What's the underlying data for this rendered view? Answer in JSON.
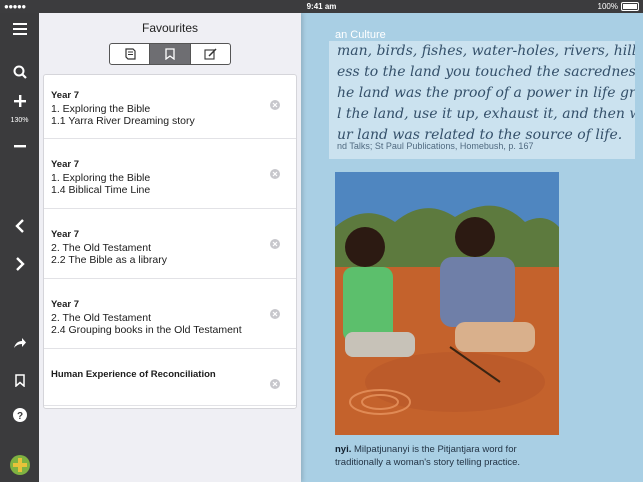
{
  "status": {
    "carrier_dots": "●●●●●",
    "time": "9:41 am",
    "battery": "100%"
  },
  "toolbar": {
    "zoom_level": "130%"
  },
  "reading": {
    "chapter_title": "an Culture",
    "quote_lines": [
      "man, birds, fishes, water-holes, rivers, hills and",
      "ess to the land you touched the sacredness of",
      "he land was the proof of a power in life greater",
      "l the land, use it up, exhaust it, and then walk",
      "ur land was related to the source of life."
    ],
    "quote_source": "nd Talks; St Paul Publications, Homebush, p. 167",
    "caption_bold": "nyi.",
    "caption_rest": " Milpatjunanyi is the Pitjantjara word for",
    "caption_line2": "traditionally a woman's story telling practice."
  },
  "favourites": {
    "title": "Favourites",
    "tabs": [
      {
        "icon": "book-icon"
      },
      {
        "icon": "bookmark-icon",
        "active": true
      },
      {
        "icon": "note-edit-icon"
      }
    ],
    "items": [
      {
        "year": "Year 7",
        "chapter": "1. Exploring the Bible",
        "section": "1.1 Yarra River Dreaming story"
      },
      {
        "year": "Year 7",
        "chapter": "1. Exploring the Bible",
        "section": "1.4 Biblical Time Line"
      },
      {
        "year": "Year 7",
        "chapter": "2. The Old Testament",
        "section": "2.2 The Bible as a library"
      },
      {
        "year": "Year 7",
        "chapter": "2. The Old Testament",
        "section": "2.4 Grouping books in the Old Testament"
      },
      {
        "year": "Human Experience of Reconciliation",
        "chapter": "",
        "section": ""
      }
    ]
  }
}
